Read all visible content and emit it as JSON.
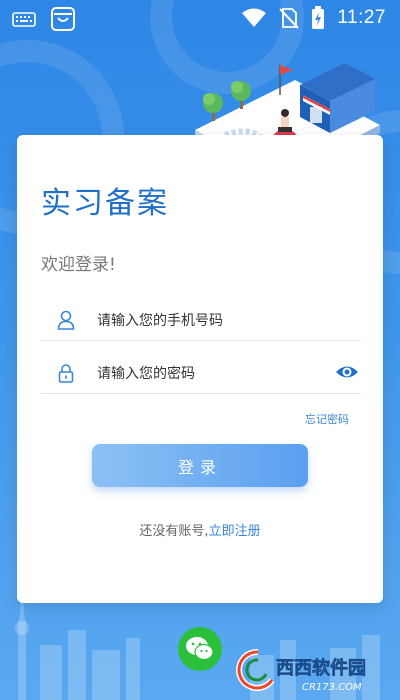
{
  "status_bar": {
    "time": "11:27",
    "left_icons": [
      "keyboard-icon",
      "shopping-bag-icon"
    ],
    "right_icons": [
      "wifi-icon",
      "no-sim-icon",
      "battery-charging-icon"
    ]
  },
  "colors": {
    "background": "#3d8fe8",
    "title": "#1f70c9",
    "link": "#3a86d8",
    "button_start": "#8cc1f4",
    "button_end": "#5a9ff0",
    "wechat": "#2bbf3c"
  },
  "login": {
    "title": "实习备案",
    "welcome": "欢迎登录!",
    "phone_placeholder": "请输入您的手机号码",
    "password_placeholder": "请输入您的密码",
    "forgot_password": "忘记密码",
    "login_button": "登录",
    "no_account_text": "还没有账号,",
    "register_link": "立即注册"
  },
  "watermark": {
    "brand": "西西软件园",
    "url": "CR173.COM"
  }
}
